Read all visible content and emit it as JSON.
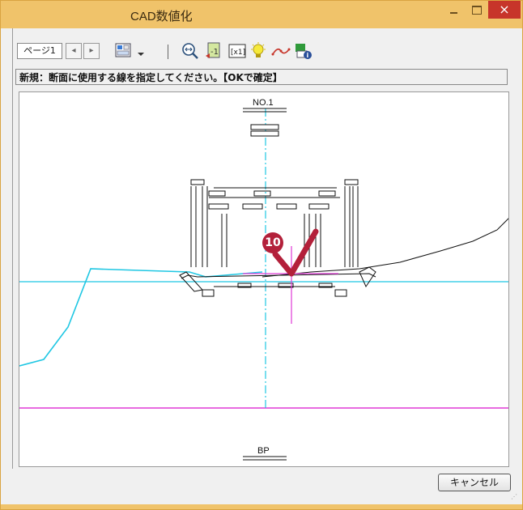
{
  "window": {
    "title": "CAD数値化",
    "close_glyph": "×"
  },
  "toolbar": {
    "page_tab": "ページ1",
    "prev_glyph": "◂",
    "next_glyph": "▸",
    "icons": [
      "layout-icon",
      "dropdown-icon",
      "zoom-icon",
      "page-back-icon",
      "scale-x1-icon",
      "bulb-icon",
      "curve-icon",
      "info-icon"
    ]
  },
  "status": {
    "message": "新規：断面に使用する線を指定してください。【OKで確定】"
  },
  "drawing": {
    "top_label": "NO.1",
    "bottom_label": "BP",
    "step_marker": "10",
    "colors": {
      "cyan": "#1fc7e3",
      "magenta": "#e03ad6",
      "accent_red": "#b3203a"
    }
  },
  "buttons": {
    "cancel_label": "キャンセル"
  }
}
